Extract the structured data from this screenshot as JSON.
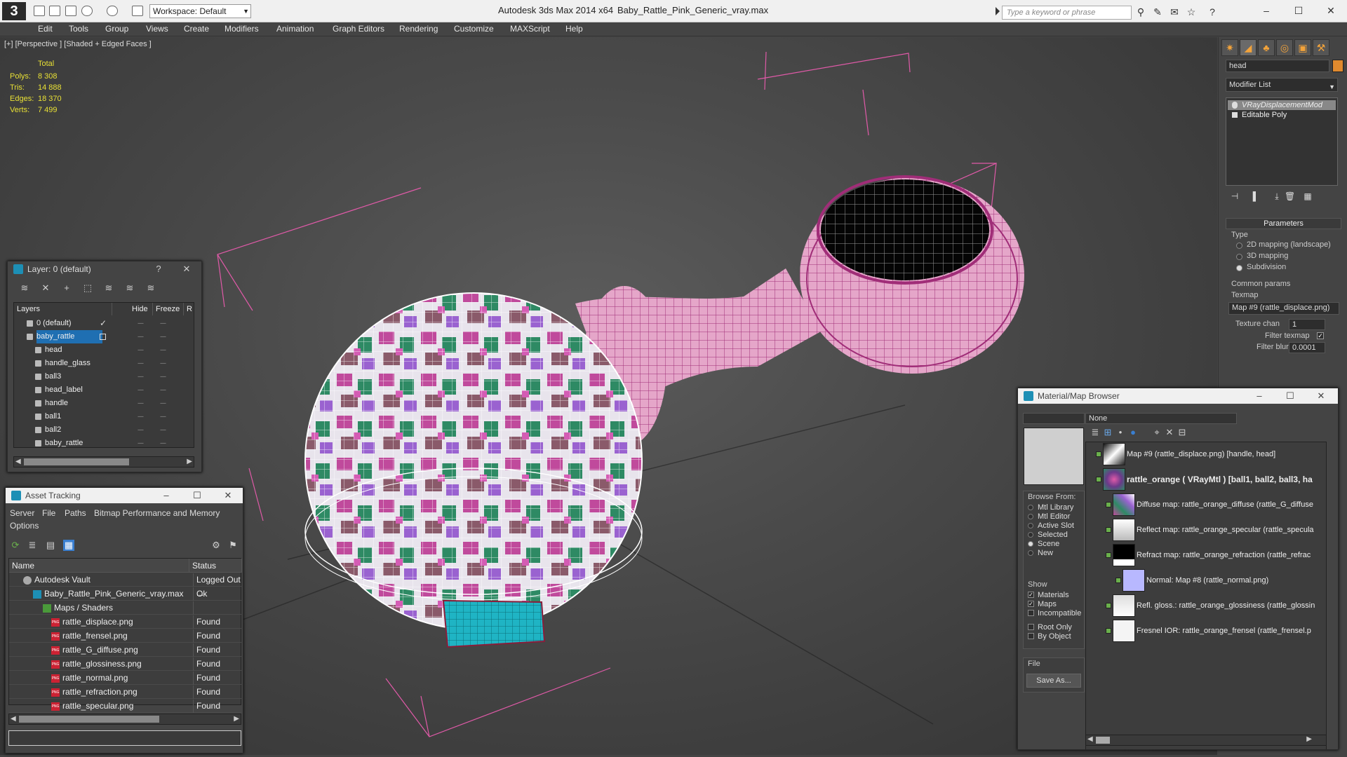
{
  "titlebar": {
    "workspace": "Workspace: Default",
    "app_title": "Autodesk 3ds Max  2014 x64",
    "file_name": "Baby_Rattle_Pink_Generic_vray.max",
    "search_placeholder": "Type a keyword or phrase"
  },
  "menu": [
    "Edit",
    "Tools",
    "Group",
    "Views",
    "Create",
    "Modifiers",
    "Animation",
    "Graph Editors",
    "Rendering",
    "Customize",
    "MAXScript",
    "Help"
  ],
  "viewport": {
    "label": "[+] [Perspective ] [Shaded + Edged Faces ]",
    "stats": {
      "total_label": "Total",
      "polys_label": "Polys:",
      "polys": "8 308",
      "tris_label": "Tris:",
      "tris": "14 888",
      "edges_label": "Edges:",
      "edges": "18 370",
      "verts_label": "Verts:",
      "verts": "7 499"
    }
  },
  "command_panel": {
    "name": "head",
    "modifier_list": "Modifier List",
    "stack": [
      "VRayDisplacementMod",
      "Editable Poly"
    ],
    "params_title": "Parameters",
    "type_label": "Type",
    "types": [
      "2D mapping (landscape)",
      "3D mapping",
      "Subdivision"
    ],
    "selected_type": "Subdivision",
    "common_params": "Common params",
    "texmap_label": "Texmap",
    "texmap_value": "Map #9 (rattle_displace.png)",
    "texture_chan_label": "Texture chan",
    "texture_chan_value": "1",
    "filter_texmap_label": "Filter texmap",
    "filter_blur_label": "Filter blur",
    "filter_blur_value": "0.0001"
  },
  "layer_dialog": {
    "title": "Layer: 0 (default)",
    "help": "?",
    "columns": [
      "Layers",
      "Hide",
      "Freeze",
      "R"
    ],
    "rows": [
      {
        "name": "0 (default)",
        "level": 1,
        "active": true
      },
      {
        "name": "baby_rattle",
        "level": 1,
        "selected": true
      },
      {
        "name": "head",
        "level": 2
      },
      {
        "name": "handle_glass",
        "level": 2
      },
      {
        "name": "ball3",
        "level": 2
      },
      {
        "name": "head_label",
        "level": 2
      },
      {
        "name": "handle",
        "level": 2
      },
      {
        "name": "ball1",
        "level": 2
      },
      {
        "name": "ball2",
        "level": 2
      },
      {
        "name": "baby_rattle",
        "level": 2
      }
    ]
  },
  "asset_tracking": {
    "title": "Asset Tracking",
    "menu": [
      "Server",
      "File",
      "Paths",
      "Bitmap Performance and Memory",
      "Options"
    ],
    "columns": [
      "Name",
      "Status"
    ],
    "rows": [
      {
        "name": "Autodesk Vault",
        "status": "Logged Out ...",
        "level": 0
      },
      {
        "name": "Baby_Rattle_Pink_Generic_vray.max",
        "status": "Ok",
        "level": 1
      },
      {
        "name": "Maps / Shaders",
        "status": "",
        "level": 2
      },
      {
        "name": "rattle_displace.png",
        "status": "Found",
        "level": 3
      },
      {
        "name": "rattle_frensel.png",
        "status": "Found",
        "level": 3
      },
      {
        "name": "rattle_G_diffuse.png",
        "status": "Found",
        "level": 3
      },
      {
        "name": "rattle_glossiness.png",
        "status": "Found",
        "level": 3
      },
      {
        "name": "rattle_normal.png",
        "status": "Found",
        "level": 3
      },
      {
        "name": "rattle_refraction.png",
        "status": "Found",
        "level": 3
      },
      {
        "name": "rattle_specular.png",
        "status": "Found",
        "level": 3
      }
    ]
  },
  "material_browser": {
    "title": "Material/Map Browser",
    "filter_value": "None",
    "browse_from_label": "Browse From:",
    "browse_from": [
      "Mtl Library",
      "Mtl Editor",
      "Active Slot",
      "Selected",
      "Scene",
      "New"
    ],
    "browse_selected": "Scene",
    "show_label": "Show",
    "show": [
      {
        "label": "Materials",
        "checked": true
      },
      {
        "label": "Maps",
        "checked": true
      },
      {
        "label": "Incompatible",
        "checked": false
      }
    ],
    "extra": [
      {
        "label": "Root Only",
        "checked": false
      },
      {
        "label": "By Object",
        "checked": false
      }
    ],
    "file_label": "File",
    "save_as": "Save As...",
    "tree": [
      {
        "label": "Map #9 (rattle_displace.png)  [handle, head]",
        "level": 0,
        "thumb": "displace"
      },
      {
        "label": "rattle_orange  ( VRayMtl )  [ball1, ball2, ball3, ha",
        "level": 0,
        "bold": true,
        "thumb": "material"
      },
      {
        "label": "Diffuse map: rattle_orange_diffuse (rattle_G_diffuse",
        "level": 1,
        "thumb": "diffuse"
      },
      {
        "label": "Reflect map: rattle_orange_specular (rattle_specula",
        "level": 1,
        "thumb": "specular"
      },
      {
        "label": "Refract map: rattle_orange_refraction (rattle_refrac",
        "level": 1,
        "thumb": "refraction"
      },
      {
        "label": "Normal: Map #8 (rattle_normal.png)",
        "level": 2,
        "thumb": "normal"
      },
      {
        "label": "Refl. gloss.: rattle_orange_glossiness (rattle_glossin",
        "level": 1,
        "thumb": "gloss"
      },
      {
        "label": "Fresnel IOR: rattle_orange_frensel (rattle_frensel.p",
        "level": 1,
        "thumb": "fresnel"
      }
    ]
  },
  "colors": {
    "accent": "#f3a33a",
    "selection": "#1f6fb2",
    "wire_pink": "#e05aa8",
    "stats_yellow": "#e8e035"
  }
}
